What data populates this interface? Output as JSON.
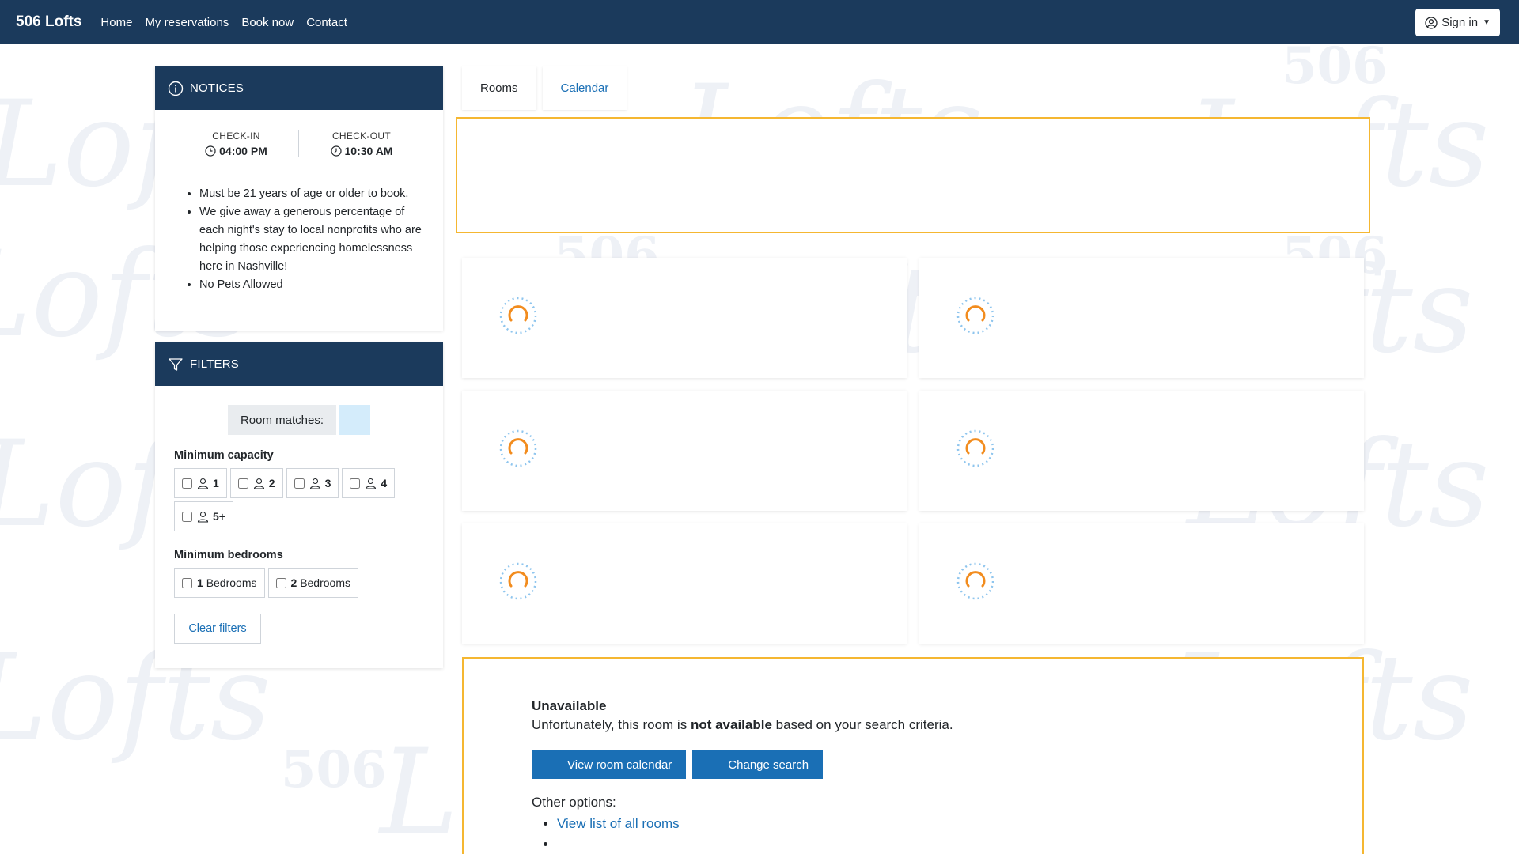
{
  "navbar": {
    "brand": "506 Lofts",
    "links": [
      "Home",
      "My reservations",
      "Book now",
      "Contact"
    ],
    "sign_in": "Sign in"
  },
  "watermark": {
    "script": "Lofts",
    "number": "506"
  },
  "notices": {
    "title": "NOTICES",
    "check_in_label": "CHECK-IN",
    "check_in_time": "04:00 PM",
    "check_out_label": "CHECK-OUT",
    "check_out_time": "10:30 AM",
    "items": [
      "Must be 21 years of age or older to book.",
      "We give away a generous percentage of each night's stay to local nonprofits who are helping those experiencing homelessness here in Nashville!",
      "No Pets Allowed"
    ]
  },
  "filters": {
    "title": "FILTERS",
    "room_matches_label": "Room matches:",
    "min_capacity_title": "Minimum capacity",
    "capacity_options": [
      "1",
      "2",
      "3",
      "4",
      "5+"
    ],
    "min_bedrooms_title": "Minimum bedrooms",
    "bedroom_options": [
      {
        "num": "1",
        "label": "Bedrooms"
      },
      {
        "num": "2",
        "label": "Bedrooms"
      }
    ],
    "clear_label": "Clear filters"
  },
  "tabs": [
    {
      "label": "Rooms",
      "active": true
    },
    {
      "label": "Calendar",
      "active": false
    }
  ],
  "unavailable": {
    "title": "Unavailable",
    "text_before": "Unfortunately, this room is ",
    "text_bold": "not available",
    "text_after": " based on your search criteria.",
    "view_calendar_label": "View room calendar",
    "change_search_label": "Change search",
    "other_options_label": "Other options:",
    "other_links": [
      "View list of all rooms",
      ""
    ]
  },
  "colors": {
    "navbar": "#1b3a5c",
    "accent": "#1a6fb5",
    "warning_border": "#f5b731",
    "spinner_orange": "#f28c1e",
    "spinner_blue": "#8ec5ee"
  },
  "icons": {
    "notices": "info-icon",
    "filters": "filter-icon",
    "sign_in": "user-circle-icon",
    "time": "clock-icon",
    "capacity": "person-icon"
  }
}
